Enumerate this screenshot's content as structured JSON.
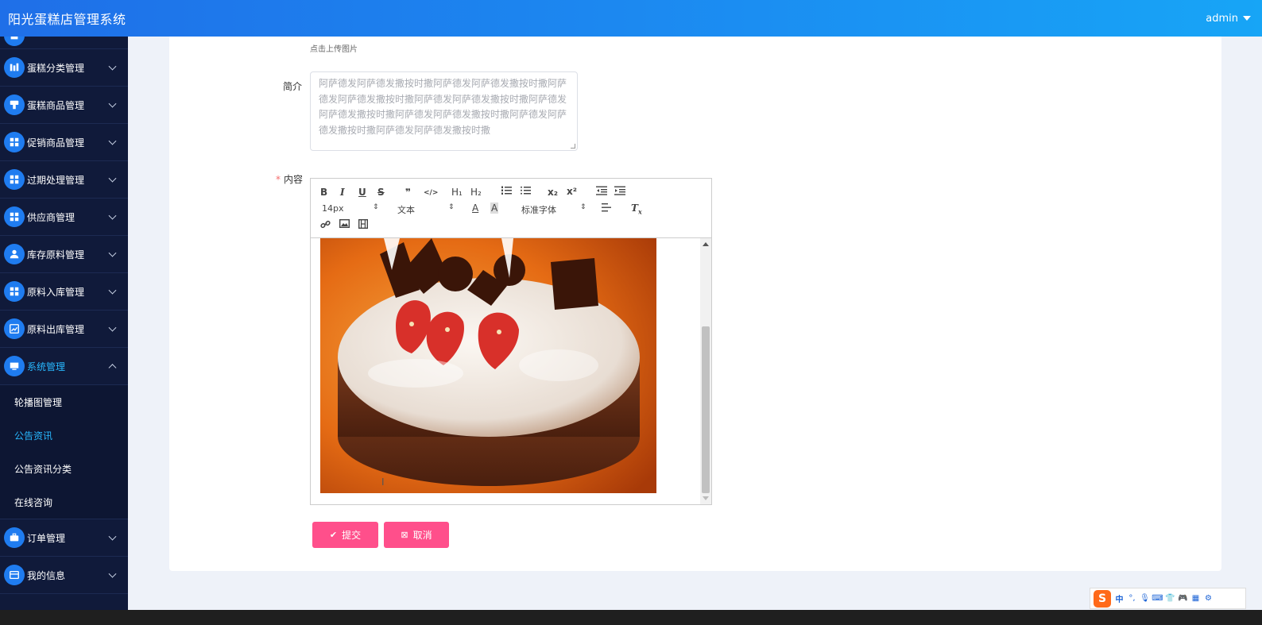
{
  "header": {
    "title": "阳光蛋糕店管理系统",
    "user": "admin"
  },
  "sidebar": {
    "items": [
      {
        "label": "蛋糕分类管理",
        "icon": "chart-bars-icon"
      },
      {
        "label": "蛋糕商品管理",
        "icon": "tag-icon"
      },
      {
        "label": "促销商品管理",
        "icon": "grid-icon"
      },
      {
        "label": "过期处理管理",
        "icon": "grid-icon"
      },
      {
        "label": "供应商管理",
        "icon": "grid-icon"
      },
      {
        "label": "库存原料管理",
        "icon": "user-icon"
      },
      {
        "label": "原料入库管理",
        "icon": "grid-icon"
      },
      {
        "label": "原料出库管理",
        "icon": "trend-icon"
      },
      {
        "label": "系统管理",
        "icon": "monitor-icon"
      }
    ],
    "sub_items": [
      {
        "label": "轮播图管理"
      },
      {
        "label": "公告资讯"
      },
      {
        "label": "公告资讯分类"
      },
      {
        "label": "在线咨询"
      }
    ],
    "bottom_items": [
      {
        "label": "订单管理",
        "icon": "briefcase-icon"
      },
      {
        "label": "我的信息",
        "icon": "card-icon"
      }
    ]
  },
  "form": {
    "upload_hint": "点击上传图片",
    "intro_label": "简介",
    "intro_value": "阿萨德发阿萨德发撒按时撒阿萨德发阿萨德发撒按时撒阿萨德发阿萨德发撒按时撒阿萨德发阿萨德发撒按时撒阿萨德发阿萨德发撒按时撒阿萨德发阿萨德发撒按时撒阿萨德发阿萨德发撒按时撒阿萨德发阿萨德发撒按时撒",
    "content_label": "内容",
    "required_mark": "*"
  },
  "editor": {
    "font_size": "14px",
    "text_type": "文本",
    "font_family": "标准字体",
    "buttons": {
      "bold": "B",
      "italic": "I",
      "underline": "U",
      "strike": "S",
      "quote": "❞",
      "code": "</>",
      "h1": "H₁",
      "h2": "H₂",
      "sub": "x₂",
      "sup": "x²"
    }
  },
  "actions": {
    "submit": "提交",
    "cancel": "取消"
  },
  "ime": {
    "lang": "中"
  },
  "colors": {
    "accent": "#1f7cf0",
    "sidebar_bg": "#101a3a",
    "button": "#ff4f8b",
    "active": "#28b8ff"
  }
}
